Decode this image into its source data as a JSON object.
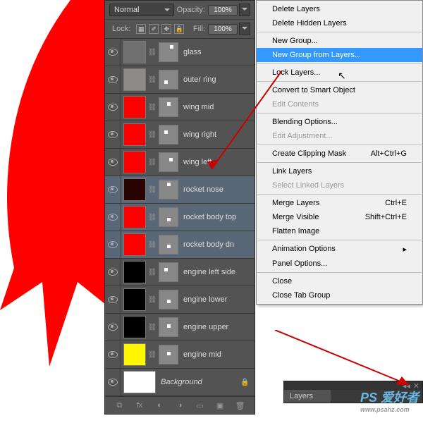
{
  "blend_mode": "Normal",
  "opacity_label": "Opacity:",
  "opacity_value": "100%",
  "lock_label": "Lock:",
  "fill_label": "Fill:",
  "fill_value": "100%",
  "layers": [
    {
      "name": "glass",
      "c": "#717070",
      "selected": false,
      "dot": {
        "l": 15,
        "t": 3
      }
    },
    {
      "name": "outer ring",
      "c": "#8f8b8b",
      "selected": false,
      "dot": {
        "l": 7,
        "t": 14
      }
    },
    {
      "name": "wing mid",
      "c": "#ff0000",
      "selected": false,
      "dot": {
        "l": 11,
        "t": 6
      }
    },
    {
      "name": "wing right",
      "c": "#ff0000",
      "selected": false,
      "dot": {
        "l": 7,
        "t": 7
      }
    },
    {
      "name": "wing left",
      "c": "#ff0000",
      "selected": false,
      "dot": {
        "l": 14,
        "t": 7
      }
    },
    {
      "name": "rocket nose",
      "c": "#2a0403",
      "selected": true,
      "dot": {
        "l": 11,
        "t": 3
      }
    },
    {
      "name": "rocket body top",
      "c": "#ff0000",
      "selected": true,
      "dot": {
        "l": 11,
        "t": 14
      }
    },
    {
      "name": "rocket body dn",
      "c": "#ff0000",
      "selected": true,
      "dot": {
        "l": 11,
        "t": 13
      }
    },
    {
      "name": "engine left side",
      "c": "#000000",
      "selected": false,
      "dot": {
        "l": 7,
        "t": 7
      }
    },
    {
      "name": "engine lower",
      "c": "#000000",
      "selected": false,
      "dot": {
        "l": 11,
        "t": 13
      }
    },
    {
      "name": "engine upper",
      "c": "#000000",
      "selected": false,
      "dot": {
        "l": 11,
        "t": 9
      }
    },
    {
      "name": "engine mid",
      "c": "#fff600",
      "selected": false,
      "dot": {
        "l": 11,
        "t": 9
      }
    }
  ],
  "background_label": "Background",
  "menu": {
    "delete_layers": "Delete Layers",
    "delete_hidden": "Delete Hidden Layers",
    "new_group": "New Group...",
    "new_group_from": "New Group from Layers...",
    "lock_layers": "Lock Layers...",
    "convert_smart": "Convert to Smart Object",
    "edit_contents": "Edit Contents",
    "blending": "Blending Options...",
    "edit_adj": "Edit Adjustment...",
    "clip_mask": "Create Clipping Mask",
    "clip_mask_key": "Alt+Ctrl+G",
    "link": "Link Layers",
    "select_linked": "Select Linked Layers",
    "merge": "Merge Layers",
    "merge_key": "Ctrl+E",
    "merge_vis": "Merge Visible",
    "merge_vis_key": "Shift+Ctrl+E",
    "flatten": "Flatten Image",
    "anim": "Animation Options",
    "panel_opts": "Panel Options...",
    "close": "Close",
    "close_tab": "Close Tab Group"
  },
  "layers_tab_label": "Layers",
  "watermark": {
    "main": "PS 爱好者",
    "sub": "www.psahz.com"
  }
}
